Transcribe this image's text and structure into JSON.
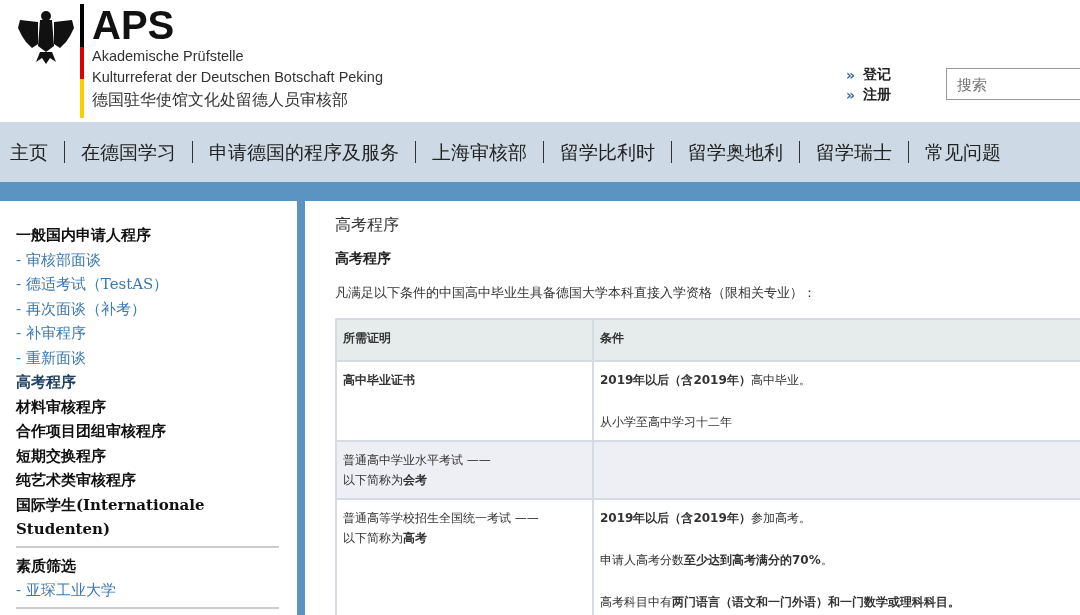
{
  "header": {
    "logo_title": "APS",
    "logo_lines": [
      "Akademische Prüfstelle",
      "Kulturreferat der Deutschen Botschaft Peking",
      "德国驻华使馆文化处留德人员审核部"
    ],
    "links": [
      {
        "arrow": "»",
        "label": "登记"
      },
      {
        "arrow": "»",
        "label": "注册"
      }
    ],
    "search": {
      "placeholder": "搜索"
    }
  },
  "nav": [
    "主页",
    "在德国学习",
    "申请德国的程序及服务",
    "上海审核部",
    "留学比利时",
    "留学奥地利",
    "留学瑞士",
    "常见问题"
  ],
  "sidebar": {
    "groups": [
      {
        "items": [
          {
            "kind": "heading",
            "label": "一般国内申请人程序",
            "selected": false
          },
          {
            "kind": "sub",
            "label": "- 审核部面谈",
            "selected": false
          },
          {
            "kind": "sub",
            "label": "- 德适考试（TestAS）",
            "selected": false
          },
          {
            "kind": "sub",
            "label": "- 再次面谈（补考）",
            "selected": false
          },
          {
            "kind": "sub",
            "label": "- 补审程序",
            "selected": false
          },
          {
            "kind": "sub",
            "label": "- 重新面谈",
            "selected": false
          },
          {
            "kind": "heading",
            "label": "高考程序",
            "selected": true
          },
          {
            "kind": "heading",
            "label": "材料审核程序",
            "selected": false
          },
          {
            "kind": "heading",
            "label": "合作项目团组审核程序",
            "selected": false
          },
          {
            "kind": "heading",
            "label": "短期交换程序",
            "selected": false
          },
          {
            "kind": "heading",
            "label": "纯艺术类审核程序",
            "selected": false
          },
          {
            "kind": "heading",
            "label": "国际学生(Internationale Studenten)",
            "selected": false
          }
        ]
      },
      {
        "items": [
          {
            "kind": "heading",
            "label": "素质筛选",
            "selected": false
          },
          {
            "kind": "sub",
            "label": "- 亚琛工业大学",
            "selected": false
          }
        ]
      }
    ]
  },
  "main": {
    "title": "高考程序",
    "subtitle": "高考程序",
    "intro": "凡满足以下条件的中国高中毕业生具备德国大学本科直接入学资格（限相关专业）：",
    "table": {
      "columns": [
        "所需证明",
        "条件"
      ],
      "rows": [
        [
          {
            "bold": true,
            "paragraphs": [
              "高中毕业证书"
            ]
          },
          {
            "bold": false,
            "paragraphs": [
              "**2019年以后（含2019年）**高中毕业。",
              "从小学至高中学习十二年"
            ]
          }
        ],
        [
          {
            "bold": false,
            "paragraphs": [
              "普通高中学业水平考试 ——\n以下简称为**会考**"
            ]
          },
          null
        ],
        [
          {
            "bold": false,
            "paragraphs": [
              "普通高等学校招生全国统一考试 ——\n以下简称为**高考**"
            ]
          },
          {
            "bold": false,
            "paragraphs": [
              "**2019年以后（含2019年）**参加高考。",
              "申请人高考分数**至少达到高考满分的70%**。",
              "高考科目中有**两门语言（语文和一门外语）和一门数学或理科科目。**"
            ]
          }
        ]
      ]
    }
  }
}
